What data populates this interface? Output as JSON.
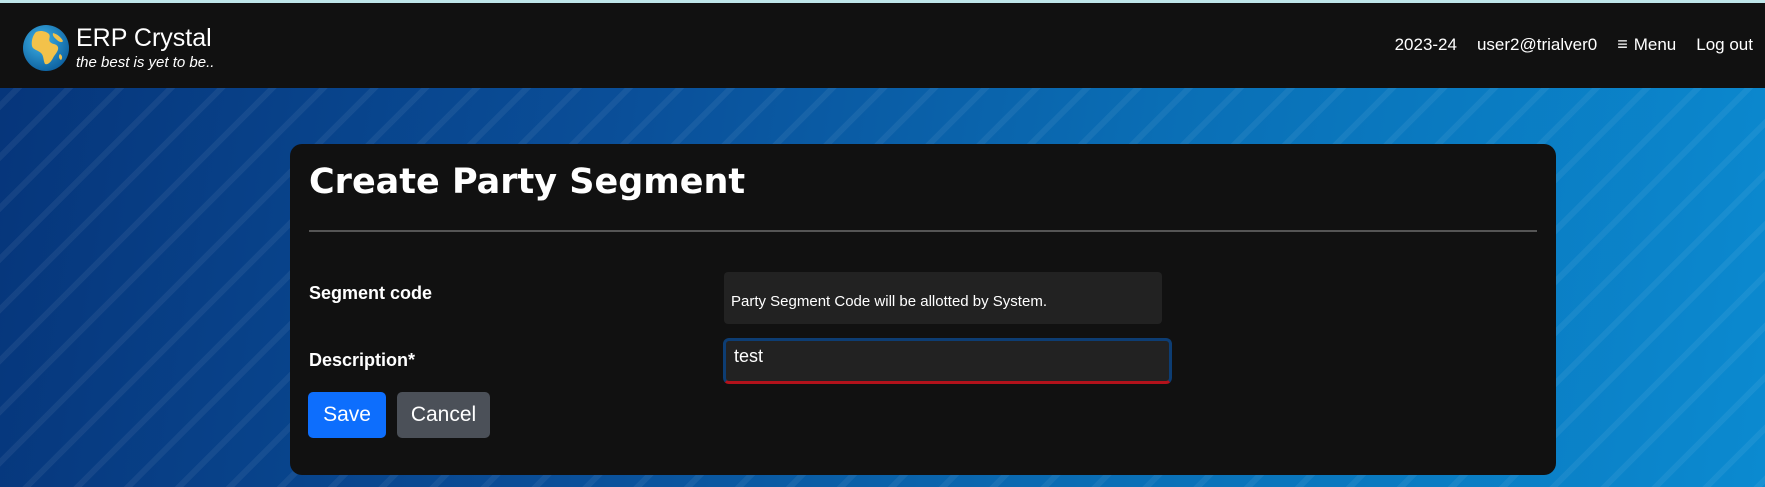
{
  "app": {
    "name": "ERP Crystal",
    "tagline": "the best is yet to be.."
  },
  "nav": {
    "fiscal_year": "2023-24",
    "user": "user2@trialver0",
    "menu_label": "Menu",
    "logout_label": "Log out"
  },
  "form": {
    "title": "Create Party Segment",
    "segment_code_label": "Segment code",
    "segment_code_info": "Party Segment Code will be allotted by System.",
    "description_label": "Description*",
    "description_value": "test",
    "save_label": "Save",
    "cancel_label": "Cancel"
  },
  "icons": {
    "logo": "globe-icon",
    "menu": "hamburger-icon"
  },
  "colors": {
    "navbar_bg": "#111111",
    "card_bg": "#111111",
    "primary": "#0d6efd",
    "secondary": "#4b5058",
    "invalid_border": "#b3121b"
  }
}
